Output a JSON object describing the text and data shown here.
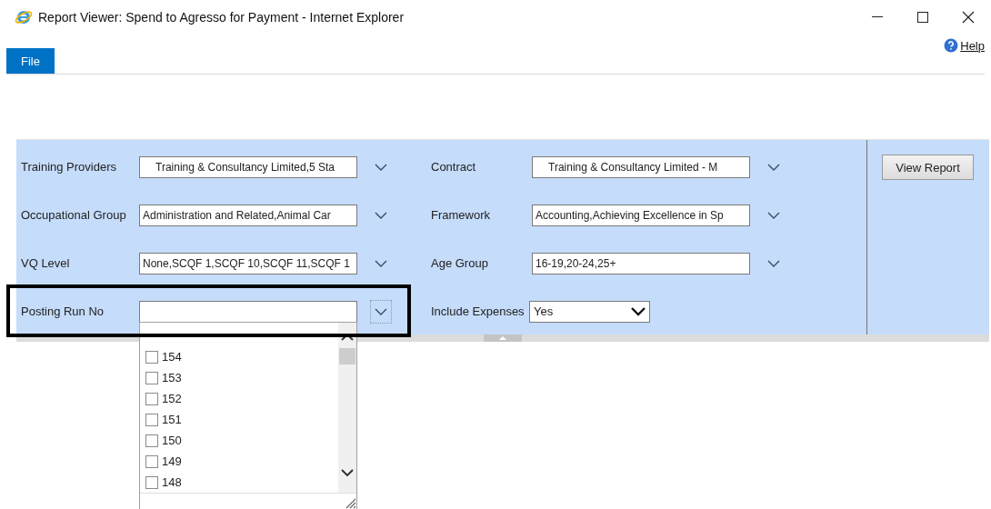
{
  "window": {
    "title": "Report Viewer: Spend to Agresso for Payment - Internet Explorer"
  },
  "menu": {
    "tabs": [
      {
        "label": "File",
        "selected": true
      }
    ],
    "help": "Help"
  },
  "parameters": [
    {
      "label": "Training Providers",
      "kind": "multiselect",
      "value": "Training & Consultancy Limited,5 Sta",
      "indented": true,
      "focused": false
    },
    {
      "label": "Contract",
      "kind": "multiselect",
      "value": "Training & Consultancy Limited - M",
      "indented": true,
      "focused": false
    },
    {
      "label": "Occupational Group",
      "kind": "multiselect",
      "value": "Administration and Related,Animal Car",
      "indented": false,
      "focused": false
    },
    {
      "label": "Framework",
      "kind": "multiselect",
      "value": "Accounting,Achieving Excellence in Sp",
      "indented": false,
      "focused": false
    },
    {
      "label": "VQ Level",
      "kind": "multiselect",
      "value": "None,SCQF 1,SCQF 10,SCQF 11,SCQF 1",
      "indented": false,
      "focused": false
    },
    {
      "label": "Age Group",
      "kind": "multiselect",
      "value": "16-19,20-24,25+",
      "indented": false,
      "focused": false
    },
    {
      "label": "Posting Run No",
      "kind": "multiselect",
      "indented": false,
      "focused": true
    },
    {
      "label": "Include Expenses",
      "kind": "select",
      "value": "Yes"
    }
  ],
  "view_report_button": "View Report",
  "dropdown": {
    "items": [
      {
        "label": "154",
        "checked": false
      },
      {
        "label": "153",
        "checked": false
      },
      {
        "label": "152",
        "checked": false
      },
      {
        "label": "151",
        "checked": false
      },
      {
        "label": "150",
        "checked": false
      },
      {
        "label": "149",
        "checked": false
      },
      {
        "label": "148",
        "checked": false
      }
    ]
  }
}
